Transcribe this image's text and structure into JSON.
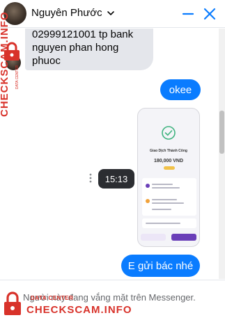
{
  "header": {
    "contact_name": "Nguyên Phước"
  },
  "messages": {
    "incoming_lines": [
      "02999121001 tp bank",
      "nguyen phan hong",
      "phuoc"
    ],
    "outgoing_okee": "okee",
    "outgoing_final": "E gửi bác nhé"
  },
  "attachment": {
    "video_time": "15:13",
    "preview_title": "Giao Dịch Thành Công",
    "preview_amount": "180,000 VND"
  },
  "footer": {
    "away_text": "Người này đang vắng mặt trên Messenger."
  },
  "watermark": {
    "brand": "CHECKSCAM.INFO",
    "sub": "DATA CENTER",
    "color": "#d8322a"
  },
  "colors": {
    "accent": "#0a7cff",
    "incoming_bubble": "#e4e6eb"
  }
}
